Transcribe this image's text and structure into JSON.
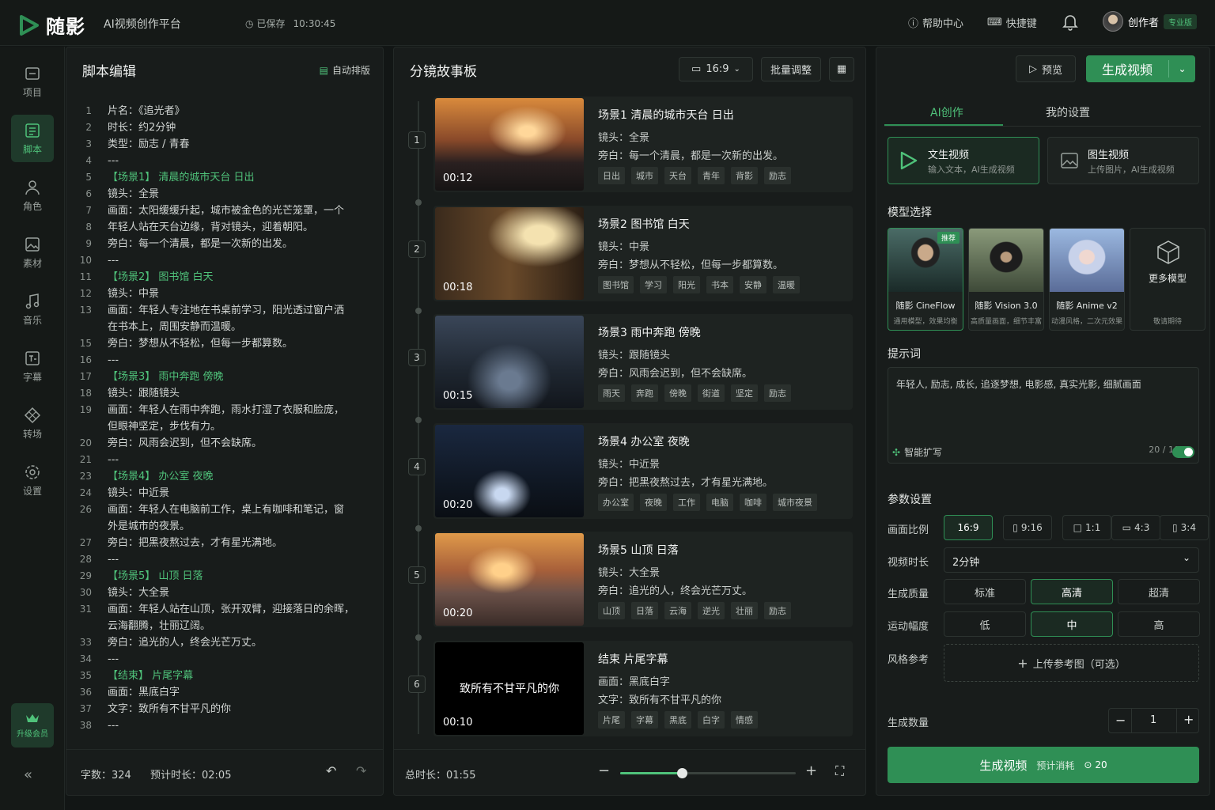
{
  "app": {
    "name": "随影",
    "subtitle": "AI视频创作平台",
    "saved": "已保存",
    "saved_time": "10:30:45",
    "help": "帮助中心",
    "shortcut": "快捷键",
    "user": "创作者",
    "badge": "专业版"
  },
  "sidebar": {
    "items": [
      {
        "label": "项目",
        "icon": "project-icon"
      },
      {
        "label": "脚本",
        "icon": "script-icon"
      },
      {
        "label": "角色",
        "icon": "character-icon"
      },
      {
        "label": "素材",
        "icon": "asset-icon"
      },
      {
        "label": "音乐",
        "icon": "music-icon"
      },
      {
        "label": "字幕",
        "icon": "subtitle-icon"
      },
      {
        "label": "转场",
        "icon": "transition-icon"
      },
      {
        "label": "设置",
        "icon": "settings-icon"
      }
    ],
    "upgrade": "升级会员",
    "collapse": "«"
  },
  "script": {
    "title": "脚本编辑",
    "auto_layout": "自动排版",
    "lines": [
      {
        "n": "1",
        "t": "片名：《追光者》"
      },
      {
        "n": "2",
        "t": "时长：约2分钟"
      },
      {
        "n": "3",
        "t": "类型：励志 / 青春"
      },
      {
        "n": "4",
        "t": "---"
      },
      {
        "n": "5",
        "t": "【场景1】 清晨的城市天台 日出",
        "g": true
      },
      {
        "n": "6",
        "t": "镜头：全景"
      },
      {
        "n": "7",
        "t": "画面：太阳缓缓升起，城市被金色的光芒笼罩，一个"
      },
      {
        "n": "8",
        "t": "年轻人站在天台边缘，背对镜头，迎着朝阳。"
      },
      {
        "n": "9",
        "t": "旁白：每一个清晨，都是一次新的出发。"
      },
      {
        "n": "10",
        "t": "---"
      },
      {
        "n": "11",
        "t": "【场景2】 图书馆 白天",
        "g": true
      },
      {
        "n": "12",
        "t": "镜头：中景"
      },
      {
        "n": "13",
        "t": "画面：年轻人专注地在书桌前学习，阳光透过窗户洒"
      },
      {
        "n": "",
        "t": "在书本上，周围安静而温暖。"
      },
      {
        "n": "15",
        "t": "旁白：梦想从不轻松，但每一步都算数。"
      },
      {
        "n": "16",
        "t": "---"
      },
      {
        "n": "17",
        "t": "【场景3】 雨中奔跑 傍晚",
        "g": true
      },
      {
        "n": "18",
        "t": "镜头：跟随镜头"
      },
      {
        "n": "19",
        "t": "画面：年轻人在雨中奔跑，雨水打湿了衣服和脸庞，"
      },
      {
        "n": "",
        "t": "但眼神坚定，步伐有力。"
      },
      {
        "n": "20",
        "t": "旁白：风雨会迟到，但不会缺席。"
      },
      {
        "n": "21",
        "t": "---"
      },
      {
        "n": "23",
        "t": "【场景4】 办公室 夜晚",
        "g": true
      },
      {
        "n": "24",
        "t": "镜头：中近景"
      },
      {
        "n": "26",
        "t": "画面：年轻人在电脑前工作，桌上有咖啡和笔记，窗"
      },
      {
        "n": "",
        "t": "外是城市的夜景。"
      },
      {
        "n": "27",
        "t": "旁白：把黑夜熬过去，才有星光满地。"
      },
      {
        "n": "28",
        "t": "---"
      },
      {
        "n": "29",
        "t": "【场景5】 山顶 日落",
        "g": true
      },
      {
        "n": "30",
        "t": "镜头：大全景"
      },
      {
        "n": "31",
        "t": "画面：年轻人站在山顶，张开双臂，迎接落日的余晖，"
      },
      {
        "n": "",
        "t": "云海翻腾，壮丽辽阔。"
      },
      {
        "n": "33",
        "t": "旁白：追光的人，终会光芒万丈。"
      },
      {
        "n": "34",
        "t": "---"
      },
      {
        "n": "35",
        "t": "【结束】 片尾字幕",
        "g": true
      },
      {
        "n": "36",
        "t": "画面：黑底白字"
      },
      {
        "n": "37",
        "t": "文字：致所有不甘平凡的你"
      },
      {
        "n": "38",
        "t": "---"
      }
    ],
    "word_count": "字数：324",
    "est_duration": "预计时长：02:05"
  },
  "board": {
    "title": "分镜故事板",
    "ratio": "16:9",
    "batch": "批量调整",
    "total": "总时长：01:55",
    "zoom": 0.35,
    "scenes": [
      {
        "num": "1",
        "dur": "00:12",
        "title": "场景1 清晨的城市天台 日出",
        "l1": "镜头：全景",
        "l2": "旁白：每一个清晨，都是一次新的出发。",
        "tags": [
          "日出",
          "城市",
          "天台",
          "青年",
          "背影",
          "励志"
        ]
      },
      {
        "num": "2",
        "dur": "00:18",
        "title": "场景2 图书馆 白天",
        "l1": "镜头：中景",
        "l2": "旁白：梦想从不轻松，但每一步都算数。",
        "tags": [
          "图书馆",
          "学习",
          "阳光",
          "书本",
          "安静",
          "温暖"
        ]
      },
      {
        "num": "3",
        "dur": "00:15",
        "title": "场景3 雨中奔跑 傍晚",
        "l1": "镜头：跟随镜头",
        "l2": "旁白：风雨会迟到，但不会缺席。",
        "tags": [
          "雨天",
          "奔跑",
          "傍晚",
          "街道",
          "坚定",
          "励志"
        ]
      },
      {
        "num": "4",
        "dur": "00:20",
        "title": "场景4 办公室 夜晚",
        "l1": "镜头：中近景",
        "l2": "旁白：把黑夜熬过去，才有星光满地。",
        "tags": [
          "办公室",
          "夜晚",
          "工作",
          "电脑",
          "咖啡",
          "城市夜景"
        ]
      },
      {
        "num": "5",
        "dur": "00:20",
        "title": "场景5 山顶 日落",
        "l1": "镜头：大全景",
        "l2": "旁白：追光的人，终会光芒万丈。",
        "tags": [
          "山顶",
          "日落",
          "云海",
          "逆光",
          "壮丽",
          "励志"
        ]
      },
      {
        "num": "6",
        "dur": "00:10",
        "title": "结束 片尾字幕",
        "l1": "画面：黑底白字",
        "l2": "文字：致所有不甘平凡的你",
        "tags": [
          "片尾",
          "字幕",
          "黑底",
          "白字",
          "情感"
        ],
        "thumb_text": "致所有不甘平凡的你"
      }
    ]
  },
  "right": {
    "preview": "预览",
    "generate": "生成视频",
    "tab_ai": "AI创作",
    "tab_settings": "我的设置",
    "mode1_title": "文生视频",
    "mode1_sub": "输入文本，AI生成视频",
    "mode2_title": "图生视频",
    "mode2_sub": "上传图片，AI生成视频",
    "model_label": "模型选择",
    "recommend": "推荐",
    "models": [
      {
        "name": "随影 CineFlow",
        "desc": "通用模型，效果均衡"
      },
      {
        "name": "随影 Vision 3.0",
        "desc": "高质量画面，细节丰富"
      },
      {
        "name": "随影 Anime v2",
        "desc": "动漫风格，二次元效果"
      },
      {
        "name": "更多模型",
        "desc": "敬请期待"
      }
    ],
    "prompt_label": "提示词",
    "prompt_text": "年轻人, 励志, 成长, 追逐梦想, 电影感, 真实光影, 细腻画面",
    "prompt_count": "20 / 1000",
    "expand": "智能扩写",
    "params": "参数设置",
    "ratio_label": "画面比例",
    "ratios": [
      "16:9",
      "9:16",
      "1:1",
      "4:3",
      "3:4"
    ],
    "duration_label": "视频时长",
    "duration": "2分钟",
    "quality_label": "生成质量",
    "qualities": [
      "标准",
      "高清",
      "超清"
    ],
    "motion_label": "运动幅度",
    "motions": [
      "低",
      "中",
      "高"
    ],
    "style_label": "风格参考",
    "upload": "上传参考图（可选）",
    "count_label": "生成数量",
    "count": "1",
    "gen_btn": "生成视频",
    "cost_label": "预计消耗",
    "cost": "20"
  },
  "colors": {
    "accent": "#2f8f55",
    "accent_text": "#4fc27a"
  }
}
